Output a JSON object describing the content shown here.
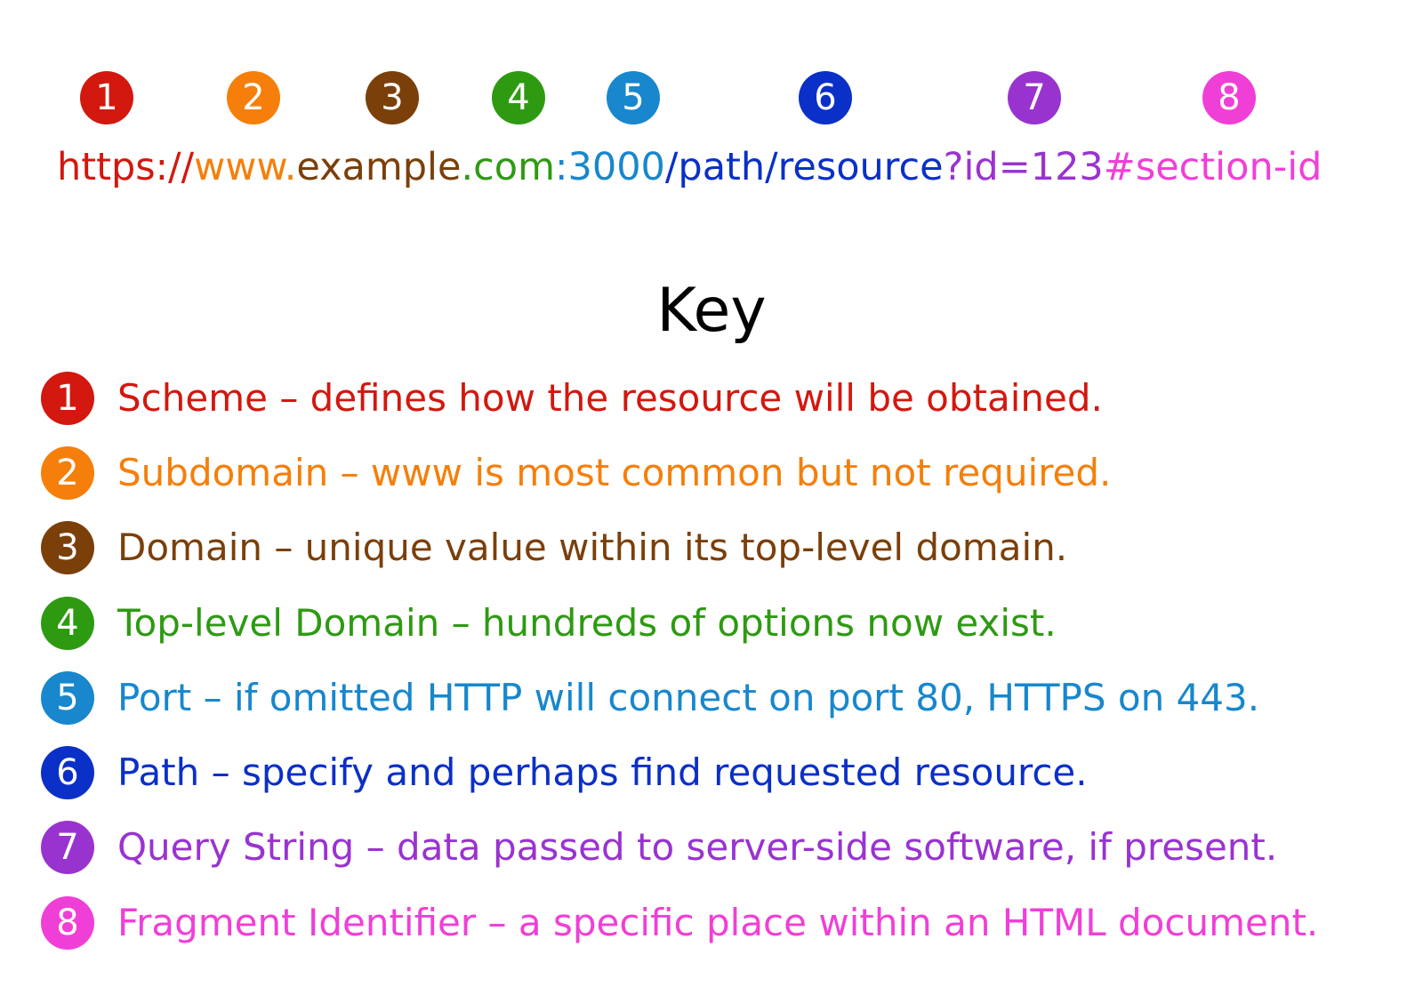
{
  "colors": {
    "scheme": "#d2180f",
    "subdomain": "#f57f0a",
    "domain": "#7b3f0a",
    "tld": "#2e9a12",
    "port": "#1887cd",
    "path": "#0b30c7",
    "query": "#9933d0",
    "fragment": "#f03fd7"
  },
  "url_parts": [
    {
      "text": "https://",
      "color": "#d2180f"
    },
    {
      "text": "www.",
      "color": "#f57f0a"
    },
    {
      "text": "example",
      "color": "#7b3f0a"
    },
    {
      "text": ".com",
      "color": "#2e9a12"
    },
    {
      "text": ":3000",
      "color": "#1887cd"
    },
    {
      "text": "/path/resource",
      "color": "#0b30c7"
    },
    {
      "text": "?id=123",
      "color": "#9933d0"
    },
    {
      "text": "#section-id",
      "color": "#f03fd7"
    }
  ],
  "top_markers": [
    {
      "num": "1",
      "color": "#d2180f"
    },
    {
      "num": "2",
      "color": "#f57f0a"
    },
    {
      "num": "3",
      "color": "#7b3f0a"
    },
    {
      "num": "4",
      "color": "#2e9a12"
    },
    {
      "num": "5",
      "color": "#1887cd"
    },
    {
      "num": "6",
      "color": "#0b30c7"
    },
    {
      "num": "7",
      "color": "#9933d0"
    },
    {
      "num": "8",
      "color": "#f03fd7"
    }
  ],
  "key": {
    "title": "Key",
    "items": [
      {
        "num": "1",
        "color": "#d2180f",
        "text": "Scheme – defines how the resource will be obtained."
      },
      {
        "num": "2",
        "color": "#f57f0a",
        "text": "Subdomain – www is most common but not required."
      },
      {
        "num": "3",
        "color": "#7b3f0a",
        "text": "Domain – unique value within its top-level domain."
      },
      {
        "num": "4",
        "color": "#2e9a12",
        "text": "Top-level Domain – hundreds of options now exist."
      },
      {
        "num": "5",
        "color": "#1887cd",
        "text": "Port – if omitted HTTP will connect on port 80, HTTPS on 443."
      },
      {
        "num": "6",
        "color": "#0b30c7",
        "text": "Path – specify and perhaps find requested resource."
      },
      {
        "num": "7",
        "color": "#9933d0",
        "text": "Query String – data passed to server-side software, if present."
      },
      {
        "num": "8",
        "color": "#f03fd7",
        "text": "Fragment Identifier – a specific place within an HTML document."
      }
    ]
  }
}
